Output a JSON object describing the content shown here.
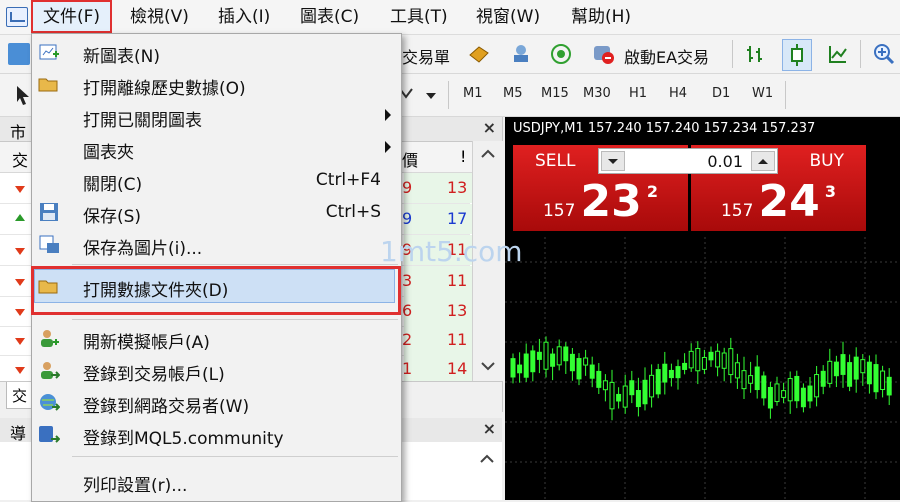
{
  "menubar": {
    "items": [
      "文件(F)",
      "檢視(V)",
      "插入(I)",
      "圖表(C)",
      "工具(T)",
      "視窗(W)",
      "幫助(H)"
    ]
  },
  "toolbar1": {
    "trade_label": "交易單",
    "ea_label": "啟動EA交易"
  },
  "toolbar2": {
    "timeframes": [
      "M1",
      "M5",
      "M15",
      "M30",
      "H1",
      "H4",
      "D1",
      "W1"
    ]
  },
  "file_menu": {
    "items": [
      {
        "label": "新圖表(N)",
        "shortcut": "",
        "submenu": false
      },
      {
        "label": "打開離線歷史數據(O)",
        "shortcut": "",
        "submenu": false
      },
      {
        "label": "打開已關閉圖表",
        "shortcut": "",
        "submenu": true
      },
      {
        "label": "圖表夾",
        "shortcut": "",
        "submenu": true
      },
      {
        "label": "關閉(C)",
        "shortcut": "Ctrl+F4",
        "submenu": false
      },
      {
        "label": "保存(S)",
        "shortcut": "Ctrl+S",
        "submenu": false
      },
      {
        "label": "保存為圖片(i)...",
        "shortcut": "",
        "submenu": false
      },
      {
        "label": "打開數據文件夾(D)",
        "shortcut": "",
        "submenu": false
      },
      {
        "label": "開新模擬帳戶(A)",
        "shortcut": "",
        "submenu": false
      },
      {
        "label": "登錄到交易帳戶(L)",
        "shortcut": "",
        "submenu": false
      },
      {
        "label": "登錄到網路交易者(W)",
        "shortcut": "",
        "submenu": false
      },
      {
        "label": "登錄到MQL5.community",
        "shortcut": "",
        "submenu": false
      },
      {
        "label": "列印設置(r)...",
        "shortcut": "",
        "submenu": false
      }
    ],
    "highlighted": "打開數據文件夾(D)"
  },
  "market_watch": {
    "title": "市",
    "col_symbol": "交",
    "col_bid": "價",
    "col_spread": "!",
    "tab": "交",
    "rows": [
      {
        "direction": "down",
        "bid_tail": "9",
        "spread": "13"
      },
      {
        "direction": "up",
        "bid_tail": "9",
        "spread": "17"
      },
      {
        "direction": "down",
        "bid_tail": "9",
        "spread": "11"
      },
      {
        "direction": "down",
        "bid_tail": "3",
        "spread": "11"
      },
      {
        "direction": "down",
        "bid_tail": "6",
        "spread": "13"
      },
      {
        "direction": "down",
        "bid_tail": "2",
        "spread": "11"
      },
      {
        "direction": "down",
        "bid_tail": "1",
        "spread": "14"
      }
    ]
  },
  "navigator": {
    "title": "導"
  },
  "chart": {
    "title": "USDJPY,M1  157.240 157.240 157.234 157.237",
    "sell_label": "SELL",
    "buy_label": "BUY",
    "lot": "0.01",
    "sell_price_small": "157",
    "sell_price_big": "23",
    "sell_price_sup": "2",
    "buy_price_small": "157",
    "buy_price_big": "24",
    "buy_price_sup": "3",
    "candle_color": "#33ff33"
  },
  "watermark": "1mt5.com",
  "colors": {
    "accent_red": "#e03030",
    "highlight_blue": "#cde0f5",
    "sell_buy_red": "#c81414"
  }
}
